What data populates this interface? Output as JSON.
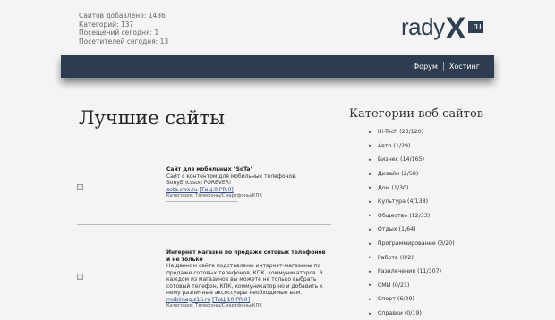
{
  "stats": [
    "Сайтов добавлено: 1436",
    "Категорий: 137",
    "Посещений сегодня: 1",
    "Посетителей сегодня: 13"
  ],
  "logo": {
    "part1": "rady",
    "part2": "X",
    "part3": ".ru"
  },
  "nav": {
    "forum": "Форум",
    "hosting": "Хостинг"
  },
  "main": {
    "title": "Лучшие сайты"
  },
  "sites": [
    {
      "title": "Сайт для мобильных \"SoTa\"",
      "desc": "Сайт с контентом для мобильных телефонов. SonyEricsson FOREVER!",
      "url": "sota.cwx.ru",
      "rank": "[ТиЦ:0,PR:0]",
      "category_label": "Категория:",
      "category": "Телефоны/Смартфоны/КПК"
    },
    {
      "title": "Интернет магазин по продаже сотовых телефонов и не только",
      "desc": "На данном сайте подставлены интернет-магазины по продаже сотовых телефонов, КПК, коммуникаторов. В каждом из магазинов вы можете не только выбрать сотовый телефон, КПК, коммуникатор но и добавить к нему различные аксессуары необходимые вам.",
      "url": "mobimag.z16.ru",
      "rank": "[ТиЦ:10,PR:0]",
      "category_label": "Категория:",
      "category": "Телефоны/Смартфоны/КПК"
    }
  ],
  "sidebar": {
    "title": "Категории веб сайтов",
    "categories": [
      "Hi-Tech (23/120)",
      "Авто (1/29)",
      "Бизнес (14/165)",
      "Дизайн (2/58)",
      "Дом (1/30)",
      "Культура (4/138)",
      "Общество (12/33)",
      "Отдых (1/64)",
      "Программирование (3/20)",
      "Работа (0/2)",
      "Развлечения (11/307)",
      "СМИ (0/21)",
      "Спорт (6/29)",
      "Справки (0/19)"
    ]
  }
}
